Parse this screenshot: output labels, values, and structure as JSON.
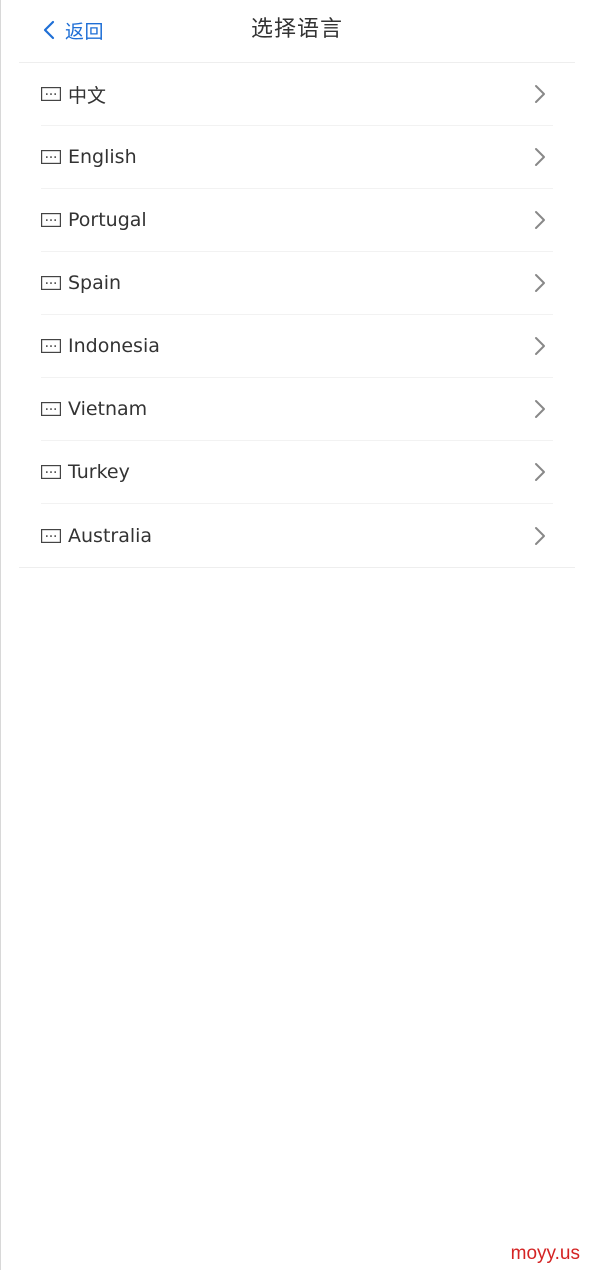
{
  "header": {
    "back_label": "返回",
    "title": "选择语言"
  },
  "languages": [
    {
      "label": "中文"
    },
    {
      "label": "English"
    },
    {
      "label": "Portugal"
    },
    {
      "label": "Spain"
    },
    {
      "label": "Indonesia"
    },
    {
      "label": "Vietnam"
    },
    {
      "label": "Turkey"
    },
    {
      "label": "Australia"
    }
  ],
  "watermark": "moyy.us",
  "colors": {
    "accent": "#1f6fd6",
    "text": "#333333",
    "chevron": "#888888",
    "watermark": "#d42323"
  },
  "icons": {
    "back": "chevron-left-icon",
    "item": "keyboard-icon",
    "arrow": "chevron-right-icon"
  }
}
